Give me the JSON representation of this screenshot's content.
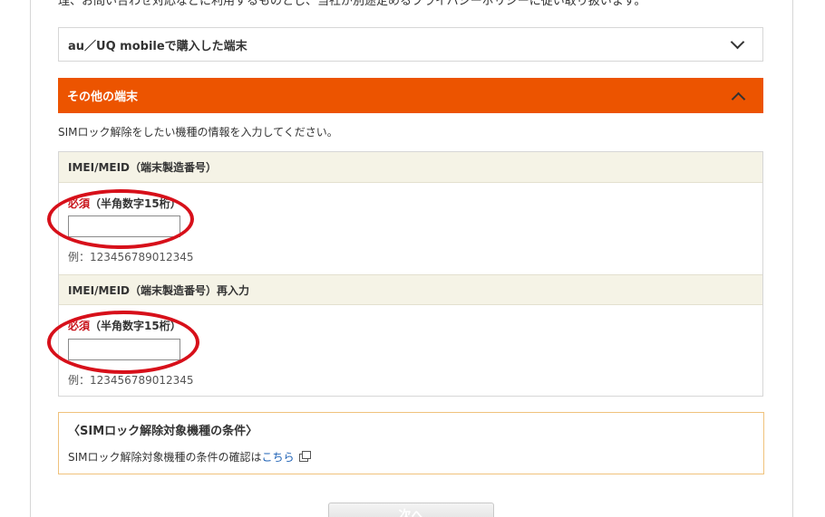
{
  "top_notice": "理、お問い合わせ対応などに利用するものとし、当社が別途定めるプライバシーポリシーに従い取り扱います。",
  "accordion_au": {
    "label": "au／UQ mobileで購入した端末",
    "state_icon": "chevron-down-icon"
  },
  "accordion_other": {
    "label": "その他の端末",
    "state_icon": "chevron-up-icon",
    "color": "#ec5400"
  },
  "intro_text": "SIMロック解除をしたい機種の情報を入力してください。",
  "imei_field": {
    "heading": "IMEI/MEID（端末製造番号）",
    "required": "必須",
    "rule": "（半角数字15桁）",
    "value": "",
    "example": "例：123456789012345"
  },
  "imei_confirm_field": {
    "heading": "IMEI/MEID（端末製造番号）再入力",
    "required": "必須",
    "rule": "（半角数字15桁）",
    "value": "",
    "example": "例：123456789012345"
  },
  "conditions": {
    "title": "〈SIMロック解除対象機種の条件〉",
    "text": "SIMロック解除対象機種の条件の確認は",
    "link": "こちら",
    "link_icon": "external-link-icon"
  },
  "next_button": {
    "label": "次へ"
  },
  "colors": {
    "accent": "#ec5400",
    "required": "#c9171e",
    "annotation_circle": "#d7101a",
    "link": "#1a5fb4"
  }
}
